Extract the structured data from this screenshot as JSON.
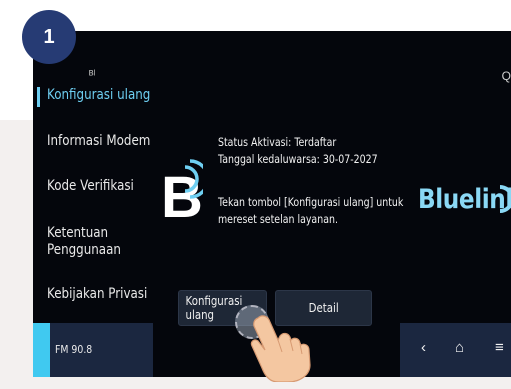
{
  "step_number": "1",
  "sidebar": {
    "items": [
      {
        "label": "Konfigurasi ulang",
        "active": true
      },
      {
        "label": "Informasi Modem"
      },
      {
        "label": "Kode Verifikasi"
      },
      {
        "label": "Ketentuan"
      },
      {
        "label": "Penggunaan"
      },
      {
        "label": "Kebijakan Privasi"
      }
    ]
  },
  "main": {
    "status_line": "Status Aktivasi: Terdaftar",
    "expiry_line": "Tanggal kedaluwarsa: 30-07-2027",
    "instruction_line1": "Tekan tombol [Konfigurasi ulang] untuk",
    "instruction_line2": "mereset setelan layanan.",
    "brand": "Bluelink",
    "buttons": {
      "reconfigure": "Konfigurasi ulang",
      "detail": "Detail"
    }
  },
  "bottom_bar": {
    "radio": "FM 90.8",
    "nav_back": "‹",
    "nav_home": "⌂",
    "nav_menu": "≡"
  },
  "colors": {
    "accent": "#6ecff2",
    "badge": "#263b74",
    "screen_bg": "#04060c"
  }
}
